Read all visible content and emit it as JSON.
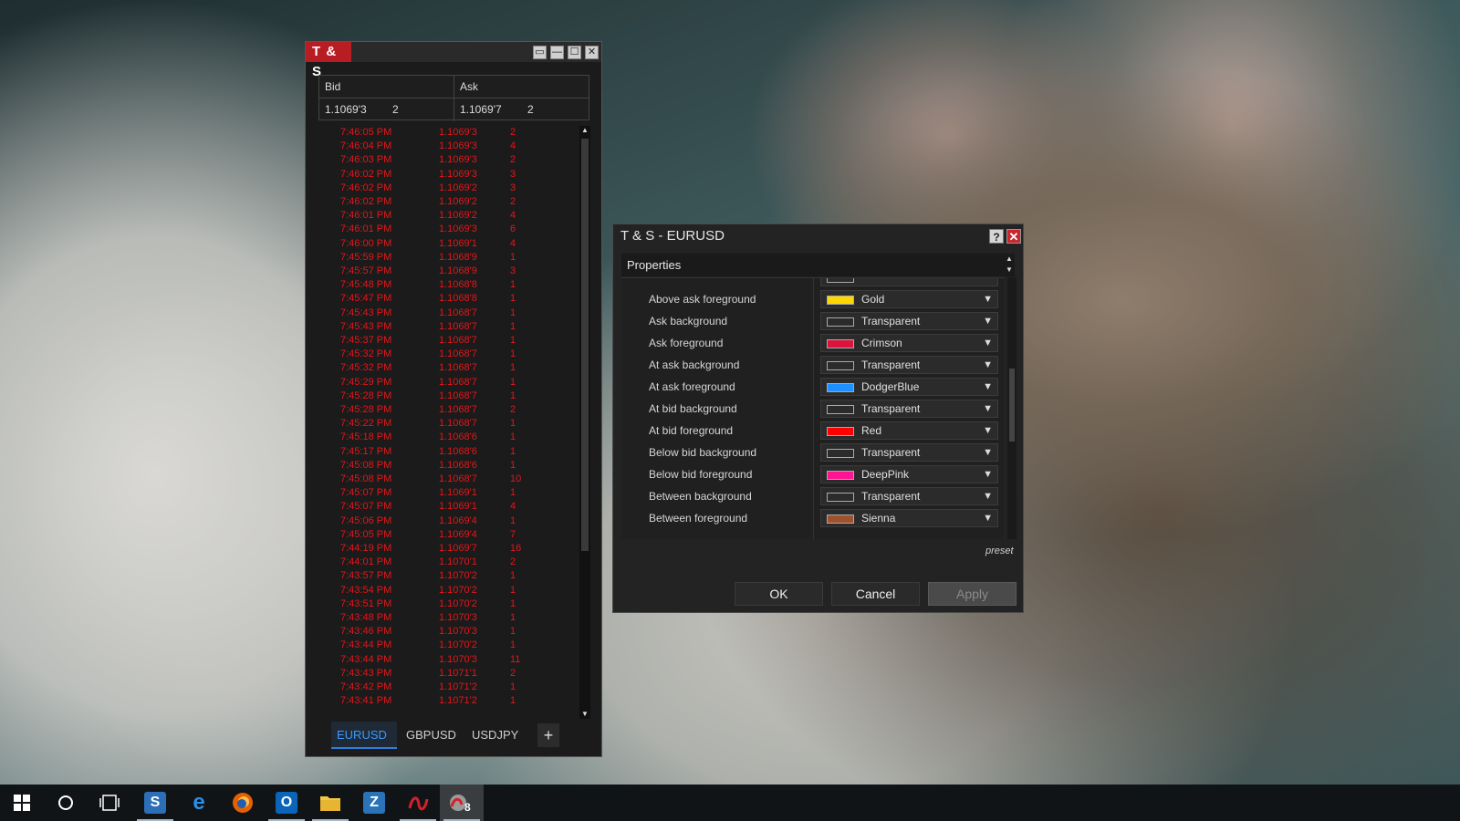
{
  "ts_window": {
    "title": "T & S",
    "controls": [
      "▭",
      "—",
      "☐",
      "✕"
    ],
    "quote": {
      "bid_header": "Bid",
      "ask_header": "Ask",
      "bid_price": "1.1069'3",
      "bid_size": "2",
      "ask_price": "1.1069'7",
      "ask_size": "2"
    },
    "trades": [
      {
        "time": "7:46:05 PM",
        "price": "1.1069'3",
        "size": "2"
      },
      {
        "time": "7:46:04 PM",
        "price": "1.1069'3",
        "size": "4"
      },
      {
        "time": "7:46:03 PM",
        "price": "1.1069'3",
        "size": "2"
      },
      {
        "time": "7:46:02 PM",
        "price": "1.1069'3",
        "size": "3"
      },
      {
        "time": "7:46:02 PM",
        "price": "1.1069'2",
        "size": "3"
      },
      {
        "time": "7:46:02 PM",
        "price": "1.1069'2",
        "size": "2"
      },
      {
        "time": "7:46:01 PM",
        "price": "1.1069'2",
        "size": "4"
      },
      {
        "time": "7:46:01 PM",
        "price": "1.1069'3",
        "size": "6"
      },
      {
        "time": "7:46:00 PM",
        "price": "1.1069'1",
        "size": "4"
      },
      {
        "time": "7:45:59 PM",
        "price": "1.1068'9",
        "size": "1"
      },
      {
        "time": "7:45:57 PM",
        "price": "1.1068'9",
        "size": "3"
      },
      {
        "time": "7:45:48 PM",
        "price": "1.1068'8",
        "size": "1"
      },
      {
        "time": "7:45:47 PM",
        "price": "1.1068'8",
        "size": "1"
      },
      {
        "time": "7:45:43 PM",
        "price": "1.1068'7",
        "size": "1"
      },
      {
        "time": "7:45:43 PM",
        "price": "1.1068'7",
        "size": "1"
      },
      {
        "time": "7:45:37 PM",
        "price": "1.1068'7",
        "size": "1"
      },
      {
        "time": "7:45:32 PM",
        "price": "1.1068'7",
        "size": "1"
      },
      {
        "time": "7:45:32 PM",
        "price": "1.1068'7",
        "size": "1"
      },
      {
        "time": "7:45:29 PM",
        "price": "1.1068'7",
        "size": "1"
      },
      {
        "time": "7:45:28 PM",
        "price": "1.1068'7",
        "size": "1"
      },
      {
        "time": "7:45:28 PM",
        "price": "1.1068'7",
        "size": "2"
      },
      {
        "time": "7:45:22 PM",
        "price": "1.1068'7",
        "size": "1"
      },
      {
        "time": "7:45:18 PM",
        "price": "1.1068'6",
        "size": "1"
      },
      {
        "time": "7:45:17 PM",
        "price": "1.1068'6",
        "size": "1"
      },
      {
        "time": "7:45:08 PM",
        "price": "1.1068'6",
        "size": "1"
      },
      {
        "time": "7:45:08 PM",
        "price": "1.1068'7",
        "size": "10"
      },
      {
        "time": "7:45:07 PM",
        "price": "1.1069'1",
        "size": "1"
      },
      {
        "time": "7:45:07 PM",
        "price": "1.1069'1",
        "size": "4"
      },
      {
        "time": "7:45:06 PM",
        "price": "1.1069'4",
        "size": "1"
      },
      {
        "time": "7:45:05 PM",
        "price": "1.1069'4",
        "size": "7"
      },
      {
        "time": "7:44:19 PM",
        "price": "1.1069'7",
        "size": "16"
      },
      {
        "time": "7:44:01 PM",
        "price": "1.1070'1",
        "size": "2"
      },
      {
        "time": "7:43:57 PM",
        "price": "1.1070'2",
        "size": "1"
      },
      {
        "time": "7:43:54 PM",
        "price": "1.1070'2",
        "size": "1"
      },
      {
        "time": "7:43:51 PM",
        "price": "1.1070'2",
        "size": "1"
      },
      {
        "time": "7:43:48 PM",
        "price": "1.1070'3",
        "size": "1"
      },
      {
        "time": "7:43:46 PM",
        "price": "1.1070'3",
        "size": "1"
      },
      {
        "time": "7:43:44 PM",
        "price": "1.1070'2",
        "size": "1"
      },
      {
        "time": "7:43:44 PM",
        "price": "1.1070'3",
        "size": "11"
      },
      {
        "time": "7:43:43 PM",
        "price": "1.1071'1",
        "size": "2"
      },
      {
        "time": "7:43:42 PM",
        "price": "1.1071'2",
        "size": "1"
      },
      {
        "time": "7:43:41 PM",
        "price": "1.1071'2",
        "size": "1"
      }
    ],
    "tabs": [
      {
        "label": "EURUSD",
        "active": true
      },
      {
        "label": "GBPUSD",
        "active": false
      },
      {
        "label": "USDJPY",
        "active": false
      }
    ],
    "add_tab_label": "+"
  },
  "dialog": {
    "title": "T & S - EURUSD",
    "help_label": "?",
    "close_label": "✕",
    "section_header": "Properties",
    "properties": [
      {
        "label": "Above ask foreground",
        "value": "Gold",
        "color": "#FFD700"
      },
      {
        "label": "Ask background",
        "value": "Transparent",
        "color": "transparent"
      },
      {
        "label": "Ask foreground",
        "value": "Crimson",
        "color": "#DC143C"
      },
      {
        "label": "At ask background",
        "value": "Transparent",
        "color": "transparent"
      },
      {
        "label": "At ask foreground",
        "value": "DodgerBlue",
        "color": "#1E90FF"
      },
      {
        "label": "At bid background",
        "value": "Transparent",
        "color": "transparent"
      },
      {
        "label": "At bid foreground",
        "value": "Red",
        "color": "#FF0000"
      },
      {
        "label": "Below bid background",
        "value": "Transparent",
        "color": "transparent"
      },
      {
        "label": "Below bid foreground",
        "value": "DeepPink",
        "color": "#FF1493"
      },
      {
        "label": "Between background",
        "value": "Transparent",
        "color": "transparent"
      },
      {
        "label": "Between foreground",
        "value": "Sienna",
        "color": "#A0522D"
      }
    ],
    "preset_label": "preset",
    "buttons": {
      "ok": "OK",
      "cancel": "Cancel",
      "apply": "Apply"
    }
  },
  "taskbar": {
    "items": [
      {
        "name": "start-button",
        "icon": "windows-logo-icon"
      },
      {
        "name": "cortana-button",
        "icon": "circle-icon"
      },
      {
        "name": "task-view-button",
        "icon": "task-view-icon"
      },
      {
        "name": "app-s",
        "icon": "s-app-icon"
      },
      {
        "name": "edge",
        "icon": "edge-icon"
      },
      {
        "name": "firefox",
        "icon": "firefox-icon"
      },
      {
        "name": "outlook",
        "icon": "outlook-icon"
      },
      {
        "name": "file-explorer",
        "icon": "folder-icon"
      },
      {
        "name": "app-z",
        "icon": "z-app-icon"
      },
      {
        "name": "trading-app",
        "icon": "trading-app-icon"
      },
      {
        "name": "trading-app-active",
        "icon": "trading-app-icon",
        "badge": "8"
      }
    ]
  },
  "colors": {
    "trade_text": "#e4161b",
    "accent_red": "#b81d24",
    "active_tab": "#3a9bff"
  }
}
